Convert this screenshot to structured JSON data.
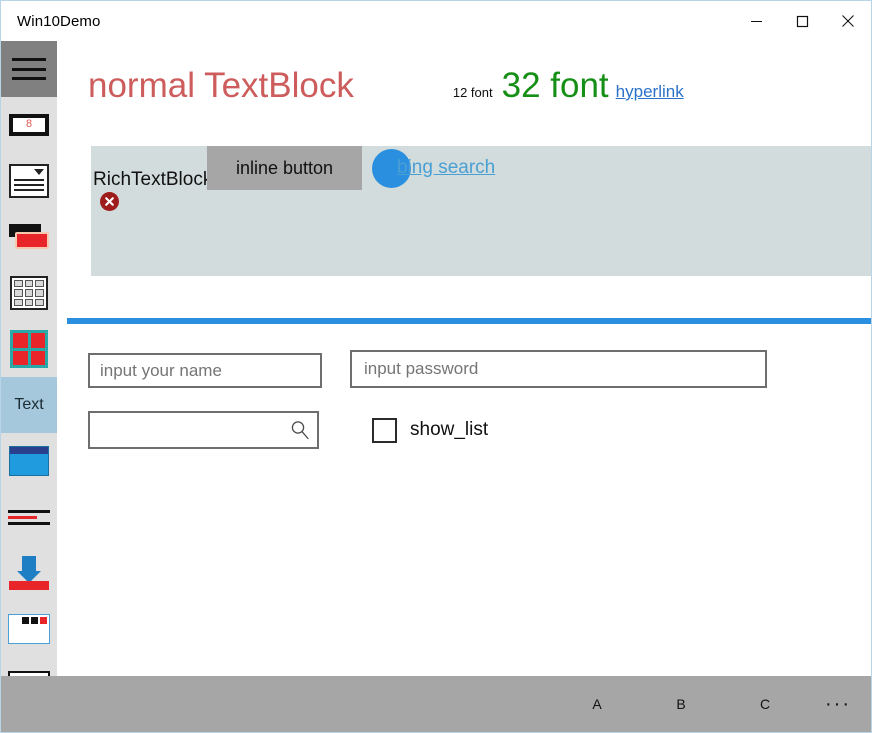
{
  "window": {
    "title": "Win10Demo",
    "caption": {
      "minimize": "minimize",
      "maximize": "maximize",
      "close": "close"
    }
  },
  "rail": {
    "menu_label": "hamburger",
    "items": [
      {
        "key": "display",
        "label": "",
        "icon": "display-icon",
        "selected": false
      },
      {
        "key": "list",
        "label": "",
        "icon": "list-icon",
        "selected": false
      },
      {
        "key": "button",
        "label": "",
        "icon": "button-icon",
        "selected": false
      },
      {
        "key": "grid",
        "label": "",
        "icon": "grid-icon",
        "selected": false
      },
      {
        "key": "tiles",
        "label": "",
        "icon": "tiles-icon",
        "selected": false
      },
      {
        "key": "text",
        "label": "Text",
        "icon": "text-label",
        "selected": true
      },
      {
        "key": "window",
        "label": "",
        "icon": "window-icon",
        "selected": false
      },
      {
        "key": "textlines",
        "label": "",
        "icon": "textlines-icon",
        "selected": false
      },
      {
        "key": "install",
        "label": "",
        "icon": "install-icon",
        "selected": false
      },
      {
        "key": "dialog",
        "label": "",
        "icon": "dialog-icon",
        "selected": false
      },
      {
        "key": "media",
        "label": "",
        "icon": "media-icon",
        "selected": false
      }
    ]
  },
  "content": {
    "headline": {
      "normal_textblock": "normal TextBlock",
      "font12": "12 font",
      "font32": "32 font",
      "hyperlink": "hyperlink"
    },
    "rich_textblock": {
      "label": "RichTextBlock",
      "inline_button": "inline button",
      "bing_link": "bing search",
      "error_badge": "error-icon"
    },
    "fields": {
      "name_placeholder": "input your name",
      "name_value": "",
      "password_placeholder": "input password",
      "password_value": "",
      "search_placeholder": "",
      "search_value": "",
      "search_icon": "search-icon",
      "checkbox_label": "show_list",
      "checkbox_checked": false
    }
  },
  "appbar": {
    "buttons": [
      {
        "label": "A"
      },
      {
        "label": "B"
      },
      {
        "label": "C"
      }
    ],
    "more": "···"
  },
  "colors": {
    "accent": "#2b8fe0",
    "title_red": "#cd5c5c",
    "green": "#158f15",
    "link": "#4a9fd4",
    "rail_bg": "#e0e0e0",
    "rail_selected": "#a5c8dd",
    "topbar": "#808080",
    "panel": "#d2dcdc",
    "appbar": "#a6a6a6"
  }
}
